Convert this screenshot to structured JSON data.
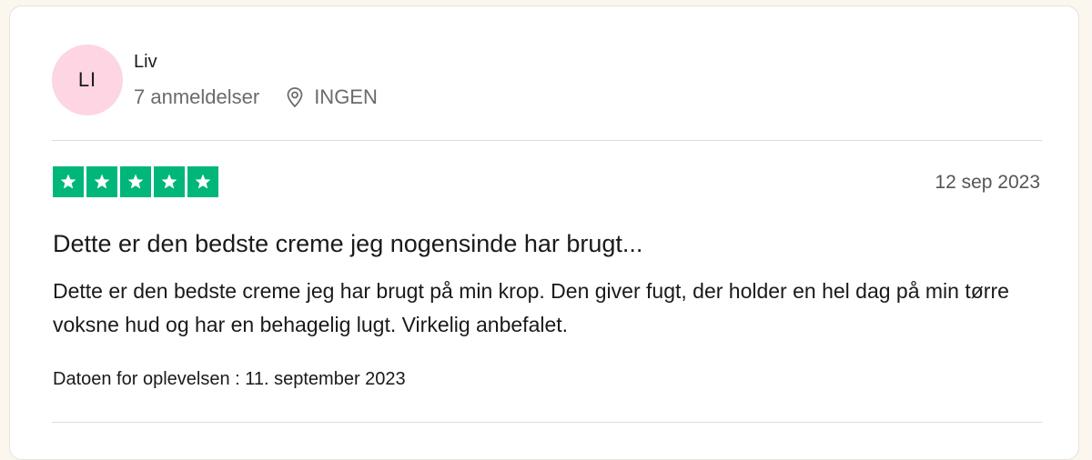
{
  "reviewer": {
    "initials": "LI",
    "name": "Liv",
    "review_count": "7 anmeldelser",
    "location_icon": "location-pin-icon",
    "location": "INGEN",
    "avatar_color": "#fdd5e3"
  },
  "review": {
    "rating": 5,
    "max_rating": 5,
    "star_color": "#00b67a",
    "date": "12 sep 2023",
    "title": "Dette er den bedste creme jeg nogensinde har brugt...",
    "body": "Dette er den bedste creme jeg har brugt på min krop. Den giver fugt, der holder en hel dag på min tørre voksne hud og har en behagelig lugt. Virkelig anbefalet.",
    "experience_date": "Datoen for oplevelsen : 11. september 2023"
  }
}
